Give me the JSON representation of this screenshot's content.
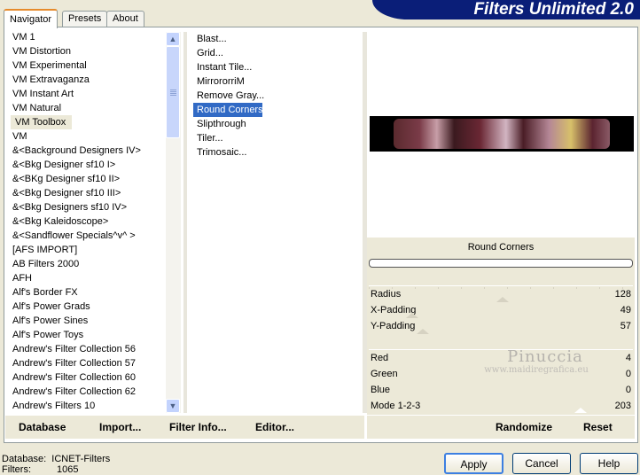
{
  "tabs": [
    "Navigator",
    "Presets",
    "About"
  ],
  "title": "Filters Unlimited 2.0",
  "categories": [
    "VM 1",
    "VM Distortion",
    "VM Experimental",
    "VM Extravaganza",
    "VM Instant Art",
    "VM Natural",
    "VM Toolbox",
    "VM",
    "&<Background Designers IV>",
    "&<Bkg Designer sf10 I>",
    "&<BKg Designer sf10 II>",
    "&<Bkg Designer sf10 III>",
    "&<Bkg Designers sf10 IV>",
    "&<Bkg Kaleidoscope>",
    "&<Sandflower Specials^v^ >",
    "[AFS IMPORT]",
    "AB Filters 2000",
    "AFH",
    "Alf's Border FX",
    "Alf's Power Grads",
    "Alf's Power Sines",
    "Alf's Power Toys",
    "Andrew's Filter Collection 56",
    "Andrew's Filter Collection 57",
    "Andrew's Filter Collection 60",
    "Andrew's Filter Collection 62",
    "Andrew's Filters 10"
  ],
  "selected_category": "VM Toolbox",
  "filters": [
    "Blast...",
    "Grid...",
    "Instant Tile...",
    "MirrororriM",
    "Remove Gray...",
    "Round Corners",
    "Slipthrough",
    "Tiler...",
    "Trimosaic..."
  ],
  "selected_filter": "Round Corners",
  "filter_name": "Round Corners",
  "params": [
    {
      "label": "Radius",
      "value": "128"
    },
    {
      "label": "X-Padding",
      "value": "49"
    },
    {
      "label": "Y-Padding",
      "value": "57"
    },
    {
      "label": "Red",
      "value": "4"
    },
    {
      "label": "Green",
      "value": "0"
    },
    {
      "label": "Blue",
      "value": "0"
    },
    {
      "label": "Mode 1-2-3",
      "value": "203"
    }
  ],
  "watermark": "Pinuccia",
  "watermark_url": "www.maidiregrafica.eu",
  "buttons_left": [
    "Database",
    "Import...",
    "Filter Info...",
    "Editor..."
  ],
  "buttons_right": [
    "Randomize",
    "Reset"
  ],
  "status": {
    "database_label": "Database:",
    "database_value": "ICNET-Filters",
    "filters_label": "Filters:",
    "filters_value": "1065"
  },
  "dialog_buttons": [
    "Apply",
    "Cancel",
    "Help"
  ],
  "icons": {
    "scroll_up": "triangle-up",
    "scroll_down": "triangle-down"
  },
  "colors": {
    "banner": "#0a1e78",
    "selection": "#316ac5",
    "tab_accent": "#e68b2c"
  }
}
